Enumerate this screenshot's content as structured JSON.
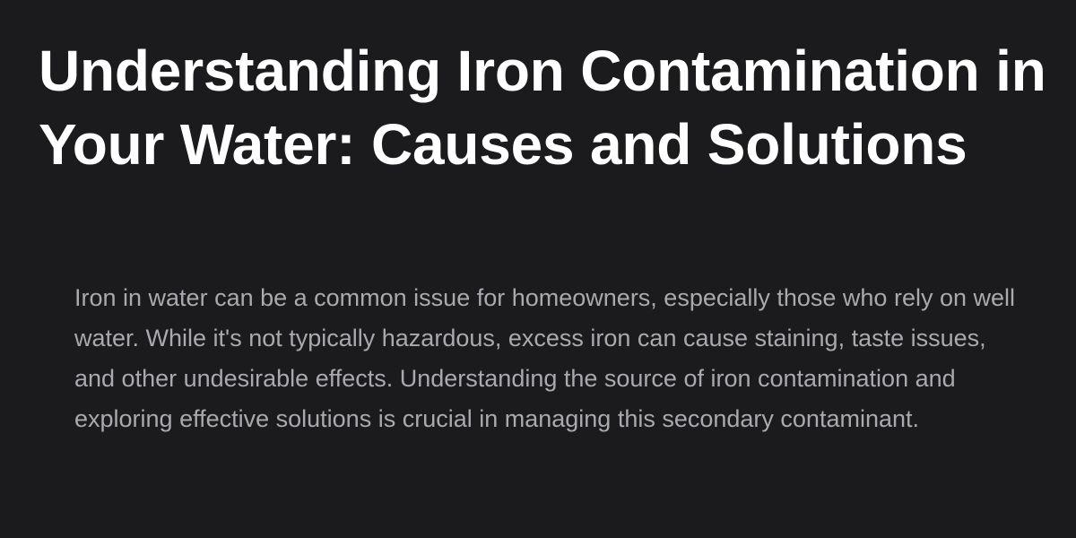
{
  "article": {
    "title": "Understanding Iron Contamination in Your Water: Causes and Solutions",
    "excerpt": "Iron in water can be a common issue for homeowners, especially those who rely on well water. While it's not typically hazardous, excess iron can cause staining, taste issues, and other undesirable effects. Understanding the source of iron contamination and exploring effective solutions is crucial in managing this secondary contaminant."
  },
  "colors": {
    "background": "#1b1b1d",
    "title": "#ffffff",
    "excerpt": "#a9a9ae"
  }
}
